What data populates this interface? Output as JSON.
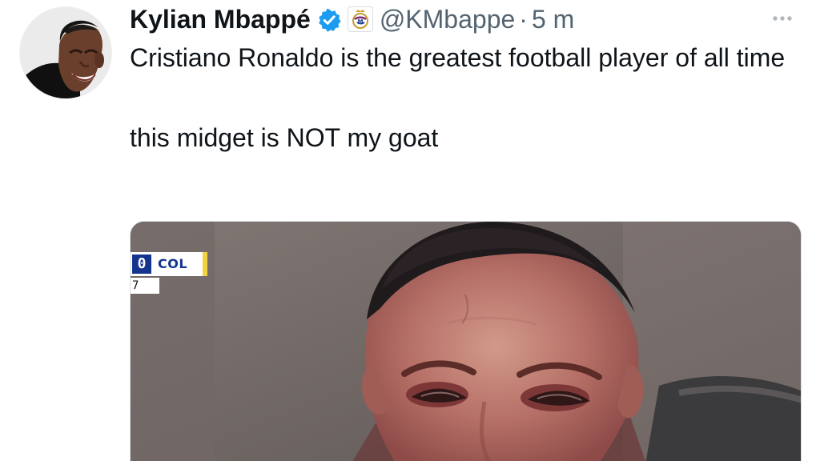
{
  "tweet": {
    "author": {
      "display_name": "Kylian Mbappé",
      "handle": "@KMbappe",
      "separator": "·",
      "time": "5 m",
      "verified_icon": "verified-badge-icon",
      "affiliation_icon": "real-madrid-crest-icon"
    },
    "text": {
      "paragraph_one": "Cristiano Ronaldo is the greatest football player of all time",
      "paragraph_two": "this midget is NOT my goat"
    },
    "media": {
      "scoreboard": {
        "score": "0",
        "team": "COL",
        "time_fragment": "7"
      }
    },
    "more_icon": "more-horizontal-icon"
  },
  "colors": {
    "text_primary": "#0f1419",
    "text_secondary": "#536471",
    "verified_blue": "#1d9bf0",
    "scoreboard_navy": "#14348d",
    "scoreboard_yellow": "#f2d33f"
  }
}
